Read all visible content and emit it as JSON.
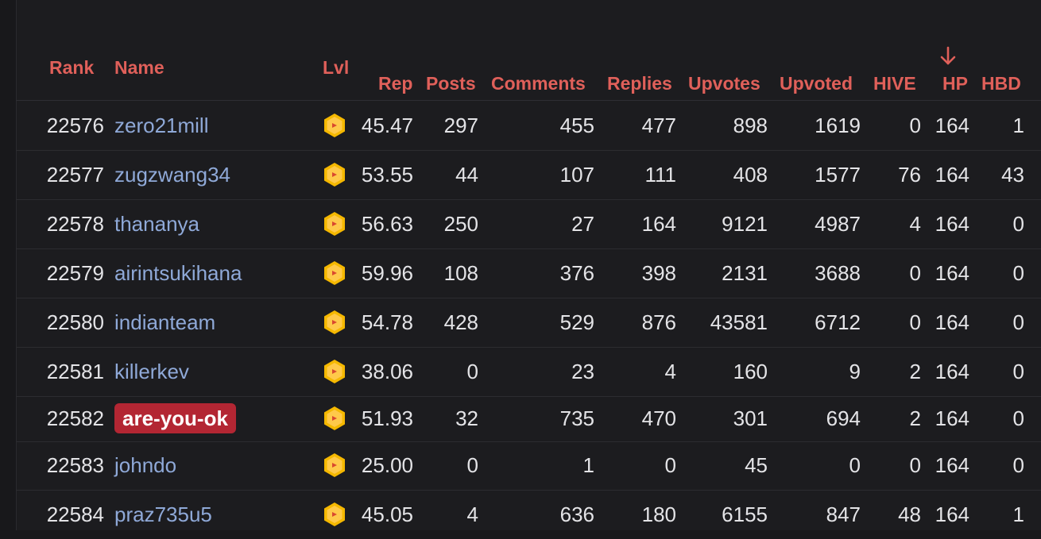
{
  "headers": {
    "rank": "Rank",
    "name": "Name",
    "lvl": "Lvl",
    "rep": "Rep",
    "posts": "Posts",
    "comments": "Comments",
    "replies": "Replies",
    "upvotes": "Upvotes",
    "upvoted": "Upvoted",
    "hive": "HIVE",
    "hp": "HP",
    "hbd": "HBD"
  },
  "sort": {
    "column": "HP",
    "direction": "descending",
    "icon": "arrow-down-icon"
  },
  "colors": {
    "header": "#e0605a",
    "username_link": "#8fa9d8",
    "highlight_bg": "#b32633",
    "badge": "#f5b800"
  },
  "rows": [
    {
      "rank": "22576",
      "name": "zero21mill",
      "lvl_icon": "level-badge-icon",
      "rep": "45.47",
      "posts": "297",
      "comments": "455",
      "replies": "477",
      "upvotes": "898",
      "upvoted": "1619",
      "hive": "0",
      "hp": "164",
      "hbd": "1",
      "highlight": false
    },
    {
      "rank": "22577",
      "name": "zugzwang34",
      "lvl_icon": "level-badge-icon",
      "rep": "53.55",
      "posts": "44",
      "comments": "107",
      "replies": "111",
      "upvotes": "408",
      "upvoted": "1577",
      "hive": "76",
      "hp": "164",
      "hbd": "43",
      "highlight": false
    },
    {
      "rank": "22578",
      "name": "thananya",
      "lvl_icon": "level-badge-icon",
      "rep": "56.63",
      "posts": "250",
      "comments": "27",
      "replies": "164",
      "upvotes": "9121",
      "upvoted": "4987",
      "hive": "4",
      "hp": "164",
      "hbd": "0",
      "highlight": false
    },
    {
      "rank": "22579",
      "name": "airintsukihana",
      "lvl_icon": "level-badge-icon",
      "rep": "59.96",
      "posts": "108",
      "comments": "376",
      "replies": "398",
      "upvotes": "2131",
      "upvoted": "3688",
      "hive": "0",
      "hp": "164",
      "hbd": "0",
      "highlight": false
    },
    {
      "rank": "22580",
      "name": "indianteam",
      "lvl_icon": "level-badge-icon",
      "rep": "54.78",
      "posts": "428",
      "comments": "529",
      "replies": "876",
      "upvotes": "43581",
      "upvoted": "6712",
      "hive": "0",
      "hp": "164",
      "hbd": "0",
      "highlight": false
    },
    {
      "rank": "22581",
      "name": "killerkev",
      "lvl_icon": "level-badge-icon",
      "rep": "38.06",
      "posts": "0",
      "comments": "23",
      "replies": "4",
      "upvotes": "160",
      "upvoted": "9",
      "hive": "2",
      "hp": "164",
      "hbd": "0",
      "highlight": false
    },
    {
      "rank": "22582",
      "name": "are-you-ok",
      "lvl_icon": "level-badge-icon",
      "rep": "51.93",
      "posts": "32",
      "comments": "735",
      "replies": "470",
      "upvotes": "301",
      "upvoted": "694",
      "hive": "2",
      "hp": "164",
      "hbd": "0",
      "highlight": true
    },
    {
      "rank": "22583",
      "name": "johndo",
      "lvl_icon": "level-badge-icon",
      "rep": "25.00",
      "posts": "0",
      "comments": "1",
      "replies": "0",
      "upvotes": "45",
      "upvoted": "0",
      "hive": "0",
      "hp": "164",
      "hbd": "0",
      "highlight": false
    },
    {
      "rank": "22584",
      "name": "praz735u5",
      "lvl_icon": "level-badge-icon",
      "rep": "45.05",
      "posts": "4",
      "comments": "636",
      "replies": "180",
      "upvotes": "6155",
      "upvoted": "847",
      "hive": "48",
      "hp": "164",
      "hbd": "1",
      "highlight": false
    }
  ]
}
